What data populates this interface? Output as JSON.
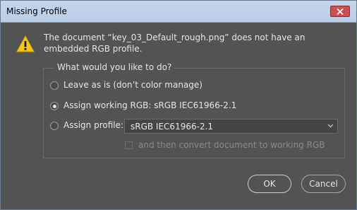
{
  "window": {
    "title": "Missing Profile"
  },
  "message": "The document “key_03_Default_rough.png” does not have an embedded RGB profile.",
  "group": {
    "title": "What would you like to do?",
    "options": [
      {
        "label": "Leave as is (don’t color manage)",
        "selected": false
      },
      {
        "label": "Assign working RGB:  sRGB IEC61966-2.1",
        "selected": true
      },
      {
        "label": "Assign profile:",
        "selected": false
      }
    ],
    "profile_select": {
      "value": "sRGB IEC61966-2.1"
    },
    "convert_checkbox": {
      "label": "and then convert document to working RGB",
      "checked": false,
      "enabled": false
    }
  },
  "buttons": {
    "ok": "OK",
    "cancel": "Cancel"
  },
  "icons": {
    "warning": "warning-triangle-icon",
    "close": "close-icon",
    "dropdown": "chevron-down-icon"
  },
  "colors": {
    "warning": "#f5c518",
    "close_button": "#c75050"
  }
}
